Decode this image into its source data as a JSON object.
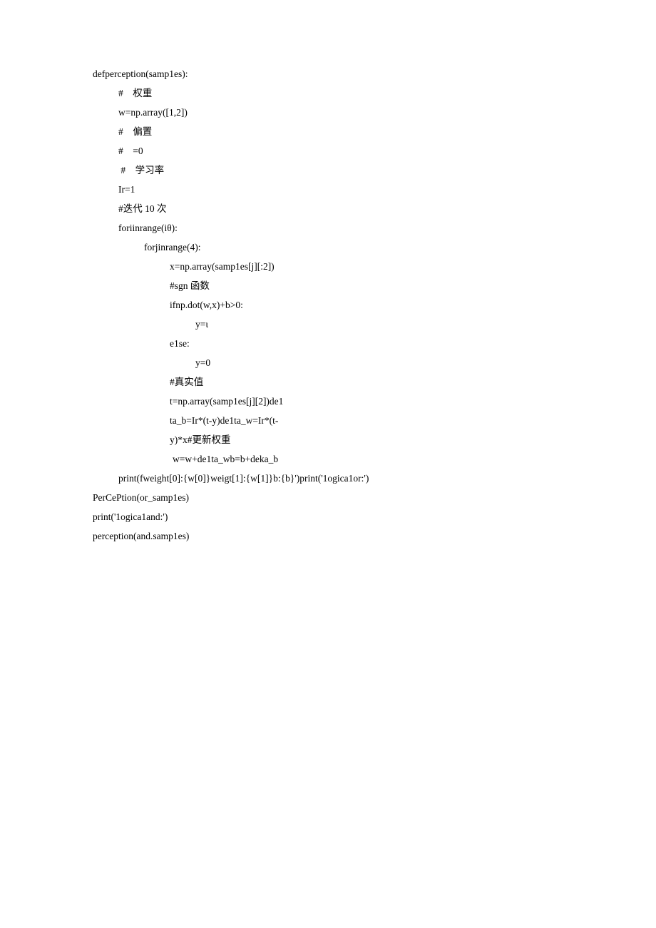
{
  "lines": [
    {
      "indent": "i0",
      "text": "defperception(samp1es):"
    },
    {
      "indent": "i1",
      "text": "#    权重"
    },
    {
      "indent": "i1",
      "text": "w=np.array([1,2])"
    },
    {
      "indent": "i1",
      "text": "#    偏置"
    },
    {
      "indent": "i1",
      "text": "#    =0"
    },
    {
      "indent": "i1",
      "text": " #    学习率"
    },
    {
      "indent": "i1",
      "text": "Ir=1"
    },
    {
      "indent": "i1",
      "text": "#迭代 10 次"
    },
    {
      "indent": "i1",
      "text": "foriinrange(iθ):"
    },
    {
      "indent": "i2",
      "text": "forjinrange(4):"
    },
    {
      "indent": "i3",
      "text": "x=np.array(samp1es[j][:2])"
    },
    {
      "indent": "i3",
      "text": "#sgn 函数"
    },
    {
      "indent": "i3",
      "text": "ifnp.dot(w,x)+b>0:"
    },
    {
      "indent": "i4",
      "text": "y=ι"
    },
    {
      "indent": "i3",
      "text": "e1se:"
    },
    {
      "indent": "i4",
      "text": "y=0"
    },
    {
      "indent": "i3",
      "text": "#真实值"
    },
    {
      "indent": "i3",
      "text": "t=np.array(samp1es[j][2])de1"
    },
    {
      "indent": "i3",
      "text": "ta_b=Ir*(t-y)de1ta_w=Ir*(t-"
    },
    {
      "indent": "i3",
      "text": "y)*x#更新权重"
    },
    {
      "indent": "i3b",
      "text": "w=w+de1ta_wb=b+deka_b"
    },
    {
      "indent": "i1",
      "text": "print(fweight[0]:{w[0]}weigt[1]:{w[1]}b:{b}')print('1ogica1or:')"
    },
    {
      "indent": "i0",
      "text": "PerCePtion(or_samp1es)"
    },
    {
      "indent": "i0",
      "text": "print('1ogica1and:')"
    },
    {
      "indent": "i0",
      "text": "perception(and.samp1es)"
    }
  ]
}
